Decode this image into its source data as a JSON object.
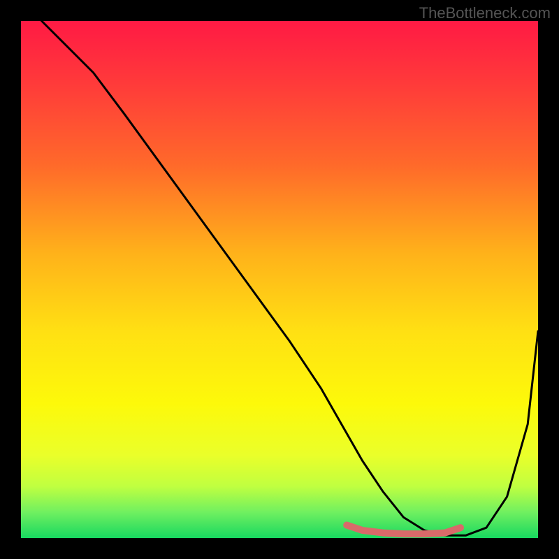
{
  "watermark": "TheBottleneck.com",
  "chart_data": {
    "type": "line",
    "title": "",
    "xlabel": "",
    "ylabel": "",
    "xlim": [
      0,
      100
    ],
    "ylim": [
      0,
      100
    ],
    "series": [
      {
        "name": "curve",
        "x": [
          4,
          8,
          14,
          20,
          28,
          36,
          44,
          52,
          58,
          62,
          66,
          70,
          74,
          78,
          82,
          86,
          90,
          94,
          98,
          100
        ],
        "y": [
          100,
          96,
          90,
          82,
          71,
          60,
          49,
          38,
          29,
          22,
          15,
          9,
          4,
          1.5,
          0.5,
          0.5,
          2,
          8,
          22,
          40
        ]
      },
      {
        "name": "highlight",
        "x": [
          63,
          66,
          70,
          74,
          78,
          82,
          85
        ],
        "y": [
          2.5,
          1.5,
          1,
          0.8,
          0.8,
          1,
          2
        ]
      }
    ],
    "gradient_stops": [
      {
        "offset": 0.0,
        "color": "#ff1a44"
      },
      {
        "offset": 0.12,
        "color": "#ff3a3a"
      },
      {
        "offset": 0.28,
        "color": "#ff6a2a"
      },
      {
        "offset": 0.45,
        "color": "#ffb21a"
      },
      {
        "offset": 0.6,
        "color": "#ffe013"
      },
      {
        "offset": 0.74,
        "color": "#fdf90a"
      },
      {
        "offset": 0.84,
        "color": "#eaff2a"
      },
      {
        "offset": 0.9,
        "color": "#c0ff40"
      },
      {
        "offset": 0.95,
        "color": "#70f060"
      },
      {
        "offset": 1.0,
        "color": "#18d860"
      }
    ],
    "curve_color": "#000000",
    "highlight_color": "#d96a6a"
  }
}
